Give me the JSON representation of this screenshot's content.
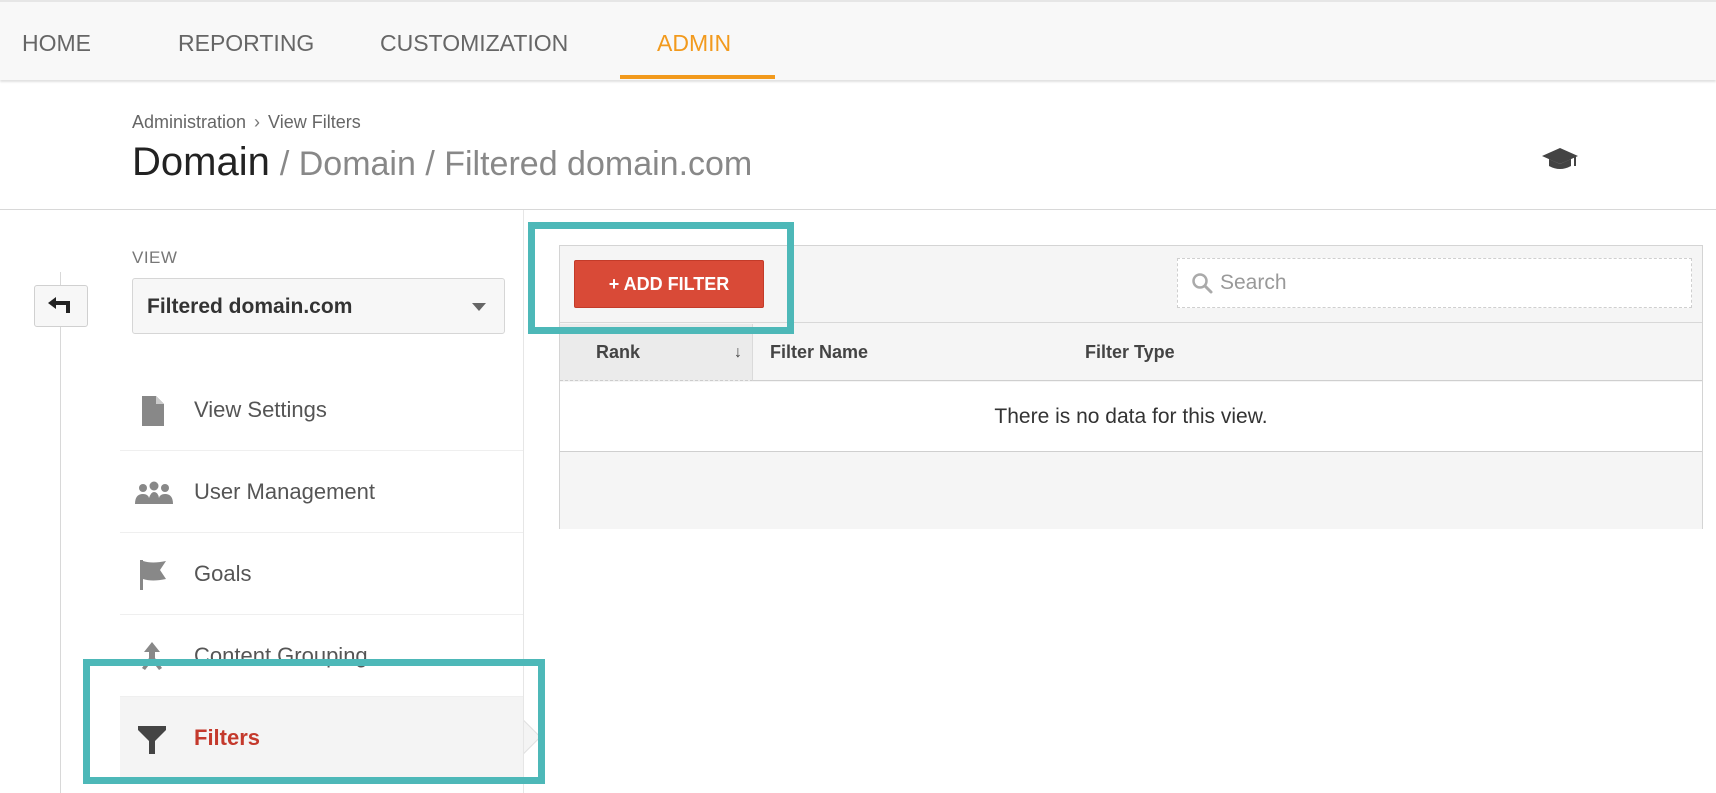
{
  "topnav": {
    "tabs": [
      {
        "label": "HOME",
        "active": false
      },
      {
        "label": "REPORTING",
        "active": false
      },
      {
        "label": "CUSTOMIZATION",
        "active": false
      },
      {
        "label": "ADMIN",
        "active": true
      }
    ]
  },
  "header": {
    "breadcrumb": [
      "Administration",
      "View Filters"
    ],
    "breadcrumb_separator": "›",
    "title": "Domain",
    "subtitle": "/ Domain / Filtered domain.com",
    "help_icon": "graduation-cap-icon"
  },
  "sidebar": {
    "back_icon": "back-arrow-icon",
    "view_label": "VIEW",
    "view_selected": "Filtered domain.com",
    "items": [
      {
        "label": "View Settings",
        "icon": "document-icon",
        "active": false
      },
      {
        "label": "User Management",
        "icon": "users-icon",
        "active": false
      },
      {
        "label": "Goals",
        "icon": "flag-icon",
        "active": false
      },
      {
        "label": "Content Grouping",
        "icon": "content-grouping-icon",
        "active": false
      },
      {
        "label": "Filters",
        "icon": "funnel-icon",
        "active": true
      }
    ]
  },
  "main": {
    "add_filter_label": "+ ADD FILTER",
    "search_placeholder": "Search",
    "search_value": "",
    "table": {
      "columns": [
        {
          "label": "Rank",
          "sort": "↓"
        },
        {
          "label": "Filter Name"
        },
        {
          "label": "Filter Type"
        }
      ],
      "rows": [],
      "empty_message": "There is no data for this view."
    }
  },
  "colors": {
    "accent_admin": "#f29a1d",
    "add_button": "#d94a37",
    "active_nav_text": "#c4392c",
    "highlight": "#4db8b8"
  }
}
